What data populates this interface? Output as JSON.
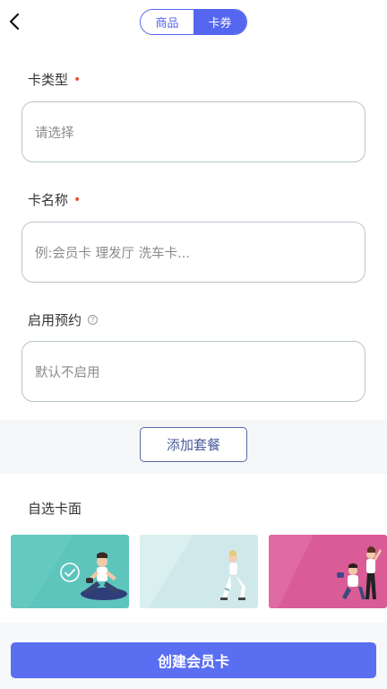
{
  "tabs": [
    {
      "label": "商品",
      "active": false
    },
    {
      "label": "卡券",
      "active": true
    }
  ],
  "form": {
    "card_type": {
      "label": "卡类型",
      "required_mark": "•",
      "value": "请选择"
    },
    "card_name": {
      "label": "卡名称",
      "required_mark": "•",
      "placeholder": "例:会员卡 理发厅 洗车卡..."
    },
    "booking": {
      "label": "启用预约",
      "help_icon_text": "?",
      "value": "默认不启用"
    }
  },
  "add_package_label": "添加套餐",
  "card_face": {
    "label": "自选卡面",
    "options": [
      {
        "name": "teal-fitness-card",
        "color": "#5ec5bd",
        "selected": true
      },
      {
        "name": "light-blue-fitness-card",
        "color": "#cfe9ea",
        "selected": false
      },
      {
        "name": "pink-fitness-card",
        "color": "#d95c96",
        "selected": false
      }
    ]
  },
  "create_button_label": "创建会员卡",
  "colors": {
    "accent": "#5a6ef2",
    "required": "#e8532b",
    "border": "#b8c4cc"
  }
}
